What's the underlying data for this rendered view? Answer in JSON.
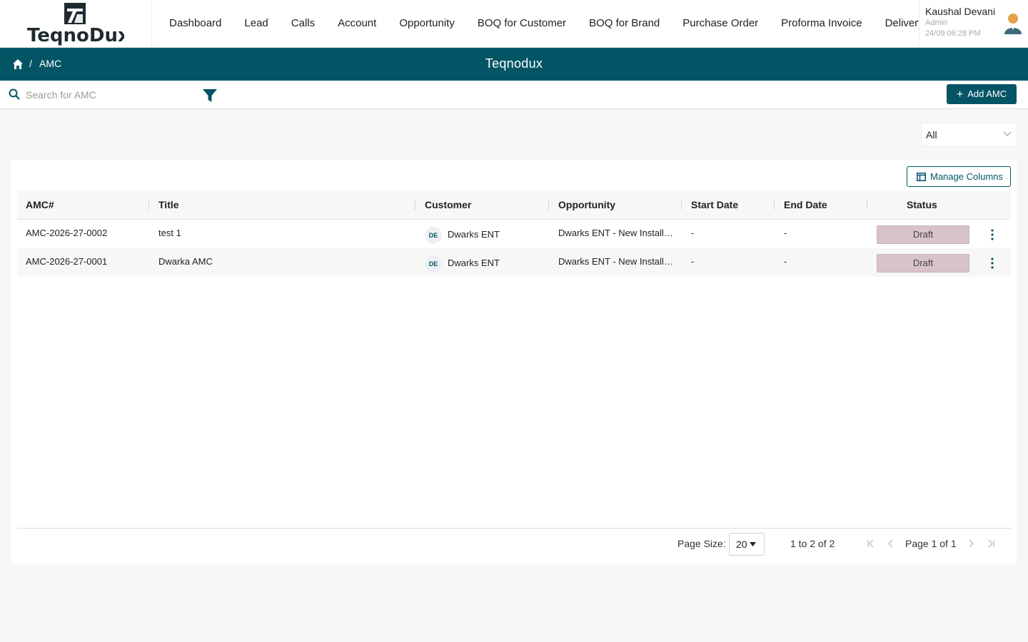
{
  "brand": {
    "logo_text": "TeqnoDux"
  },
  "nav": {
    "items": [
      "Dashboard",
      "Lead",
      "Calls",
      "Account",
      "Opportunity",
      "BOQ for Customer",
      "BOQ for Brand",
      "Purchase Order",
      "Proforma Invoice",
      "Delivery"
    ]
  },
  "user": {
    "name": "Kaushal Devani",
    "role": "Admin",
    "time": "24/09 06:28 PM"
  },
  "breadcrumb": {
    "separator": "/",
    "current": "AMC",
    "title": "Teqnodux"
  },
  "toolbar": {
    "search_placeholder": "Search for AMC",
    "add_label": "Add AMC",
    "add_icon": "plus-icon"
  },
  "status_filter": {
    "selected": "All"
  },
  "table": {
    "manage_columns_label": "Manage Columns",
    "headers": [
      "AMC#",
      "Title",
      "Customer",
      "Opportunity",
      "Start Date",
      "End Date",
      "Status"
    ],
    "rows": [
      {
        "id": "AMC-2026-27-0002",
        "title": "test 1",
        "customer_initials": "DE",
        "customer": "Dwarks ENT",
        "opportunity": "Dwarks ENT - New Installation",
        "start": "-",
        "end": "-",
        "status": "Draft"
      },
      {
        "id": "AMC-2026-27-0001",
        "title": "Dwarka AMC",
        "customer_initials": "DE",
        "customer": "Dwarks ENT",
        "opportunity": "Dwarks ENT - New Installation",
        "start": "-",
        "end": "-",
        "status": "Draft"
      }
    ]
  },
  "pagination": {
    "page_size_label": "Page Size:",
    "page_size": "20",
    "range": "1 to 2 of 2",
    "page_text": "Page 1 of 1"
  },
  "colors": {
    "primary": "#035566",
    "status_draft": "#d9c3cb"
  }
}
